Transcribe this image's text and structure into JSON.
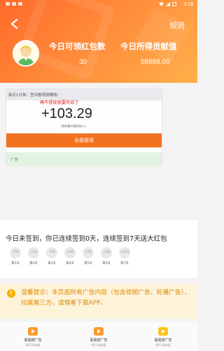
{
  "status_bar": {
    "time": "3:28"
  },
  "header": {
    "rules_label": "规则",
    "today_redpacket_label": "今日可领红包数",
    "today_redpacket_value": "30",
    "today_contribution_label": "今日所得贡献值",
    "today_contribution_value": "58888.00"
  },
  "ad_card": {
    "tip_text": "每天1分钟，签到看视频赚钱！",
    "warning_text": "再不提现就要失效了",
    "amount": "+103.29",
    "amount_note": "(您有额外赠送收入)",
    "button_label": "全部提现",
    "ad_label": "广告"
  },
  "sign_in": {
    "title": "今日未签到，你已连续签到0天，连续签到7天送大红包",
    "days": [
      {
        "reward": "+58",
        "label": "第1天"
      },
      {
        "reward": "+58",
        "label": "第2天"
      },
      {
        "reward": "+58",
        "label": "第3天"
      },
      {
        "reward": "+58",
        "label": "第4天"
      },
      {
        "reward": "+58",
        "label": "第5天"
      },
      {
        "reward": "+58",
        "label": "第6天"
      },
      {
        "reward": "+218",
        "label": "第7天"
      }
    ]
  },
  "tip": {
    "text": "温馨提示：本页面所有广告内容（包含视频广告、轮播广告），均属第三方，请慎重下载APP。"
  },
  "nav": [
    {
      "label": "看视频广告",
      "sub": "得15贡献值",
      "icon": "video-icon"
    },
    {
      "label": "看视频广告",
      "sub": "得15贡献值",
      "icon": "video-icon"
    },
    {
      "label": "看视频广告",
      "sub": "得15贡献值",
      "icon": "video-icon"
    }
  ],
  "colors": {
    "header_start": "#ff6a2a",
    "header_end": "#ffb04a",
    "button": "#f2731f",
    "tip_text": "#e08a00",
    "tip_bg": "#fdf3d9"
  }
}
